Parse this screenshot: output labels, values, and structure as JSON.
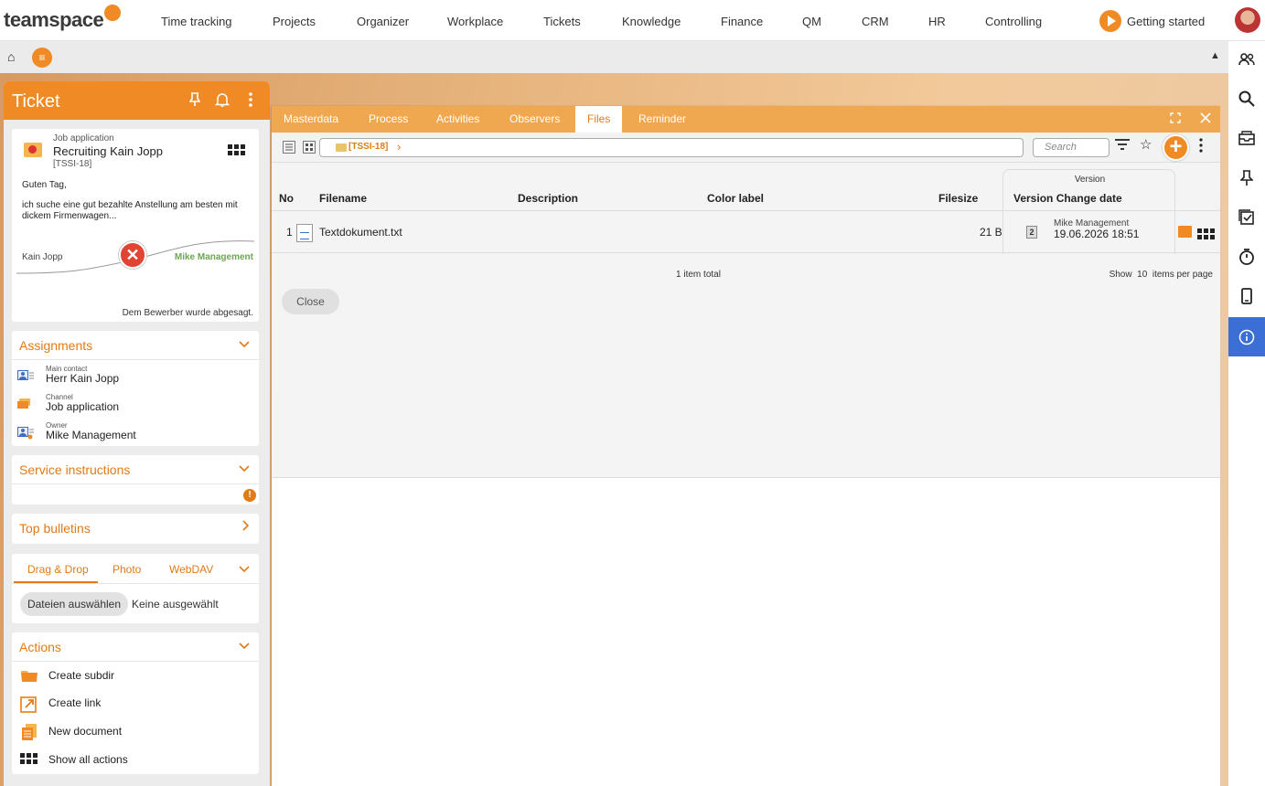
{
  "topnav": {
    "logo": "teamspace",
    "items": [
      "Time tracking",
      "Projects",
      "Organizer",
      "Workplace",
      "Tickets",
      "Knowledge",
      "Finance",
      "QM",
      "CRM",
      "HR",
      "Controlling"
    ],
    "getting_started": "Getting started"
  },
  "subbar": {
    "home_icon": "home-icon",
    "menu_icon": "menu-icon",
    "collapse_icon": "triangle-up-icon"
  },
  "ticket": {
    "title": "Ticket",
    "summary": {
      "type": "Job application",
      "name": "Recruiting Kain Jopp",
      "code": "[TSSI-18]",
      "greeting": "Guten Tag,",
      "body": "ich suche eine gut bezahlte Anstellung am besten mit dickem Firmenwagen...",
      "from": "Kain Jopp",
      "to": "Mike Management",
      "status": "Dem Bewerber wurde abgesagt."
    },
    "assignments": {
      "title": "Assignments",
      "rows": [
        {
          "label": "Main contact",
          "value": "Herr Kain Jopp"
        },
        {
          "label": "Channel",
          "value": "Job application"
        },
        {
          "label": "Owner",
          "value": "Mike Management"
        }
      ]
    },
    "service_instructions": {
      "title": "Service instructions"
    },
    "top_bulletins": {
      "title": "Top bulletins"
    },
    "upload": {
      "tabs": [
        "Drag & Drop",
        "Photo",
        "WebDAV"
      ],
      "file_button": "Dateien auswählen",
      "no_file": "Keine ausgewählt"
    },
    "actions": {
      "title": "Actions",
      "items": [
        "Create subdir",
        "Create link",
        "New document",
        "Show all actions"
      ]
    }
  },
  "window": {
    "tabs": [
      "Masterdata",
      "Process",
      "Activities",
      "Observers",
      "Files",
      "Reminder"
    ],
    "active_tab": "Files",
    "path": "[TSSI-18]",
    "search_placeholder": "Search",
    "columns": {
      "no": "No",
      "filename": "Filename",
      "description": "Description",
      "color_label": "Color label",
      "filesize": "Filesize",
      "version_group": "Version",
      "version_change_date": "Version Change date"
    },
    "rows": [
      {
        "no": "1",
        "filename": "Textdokument.txt",
        "description": "",
        "color_label": "",
        "filesize": "21 B",
        "version": "2",
        "owner": "Mike Management",
        "date": "19.06.2026 18:51"
      }
    ],
    "pager": {
      "total": "1 item total",
      "show": "Show",
      "count": "10",
      "per_page": "items per page"
    },
    "close_button": "Close"
  },
  "colors": {
    "accent": "#f08a24",
    "accent_text": "#e07b18",
    "active_sidebar": "#3c6fd6"
  }
}
